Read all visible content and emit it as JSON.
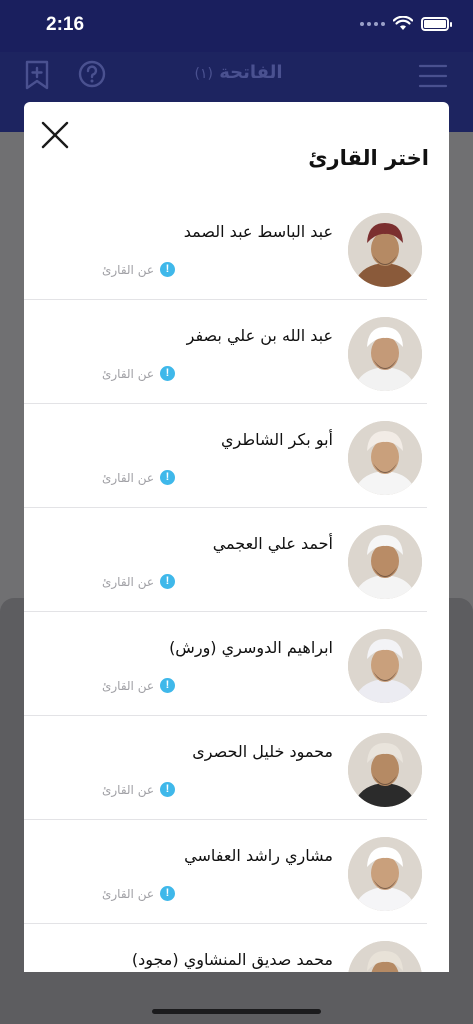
{
  "status_bar": {
    "time": "2:16"
  },
  "nav": {
    "title": "الفاتحة",
    "subtitle": "(١)"
  },
  "modal": {
    "title": "اختر القارئ",
    "about_label": "عن القارئ",
    "info_glyph": "!",
    "readers": [
      {
        "name": "عبد الباسط عبد الصمد",
        "skin": "#b58a64",
        "garment": "#8a5a3a",
        "headwear": "#7b2f2f"
      },
      {
        "name": "عبد الله بن علي بصفر",
        "skin": "#c49a78",
        "garment": "#f2f2f2",
        "headwear": "#ffffff"
      },
      {
        "name": "أبو بكر الشاطري",
        "skin": "#c9a07c",
        "garment": "#f5f5f5",
        "headwear": "#f2ece6"
      },
      {
        "name": "أحمد علي العجمي",
        "skin": "#b98c66",
        "garment": "#f4f4f4",
        "headwear": "#f6f6f6"
      },
      {
        "name": "ابراهيم الدوسري (ورش)",
        "skin": "#c9a07c",
        "garment": "#ececf2",
        "headwear": "#f3f3f6"
      },
      {
        "name": "محمود خليل الحصرى",
        "skin": "#b58a64",
        "garment": "#2b2b2b",
        "headwear": "#e9e4dc"
      },
      {
        "name": "مشاري راشد العفاسي",
        "skin": "#c9a07c",
        "garment": "#f5f5f7",
        "headwear": "#ffffff"
      },
      {
        "name": "محمد صديق المنشاوي (مجود)",
        "skin": "#b58a64",
        "garment": "#6b5a48",
        "headwear": "#e8e2d8"
      }
    ]
  },
  "colors": {
    "nav_background": "#1d2460",
    "info_accent": "#3fb8ea"
  },
  "icons": {
    "nav_left_1": "bookmark-plus-icon",
    "nav_left_2": "help-icon",
    "nav_right": "menu-icon",
    "close": "close-icon",
    "info": "info-icon"
  }
}
